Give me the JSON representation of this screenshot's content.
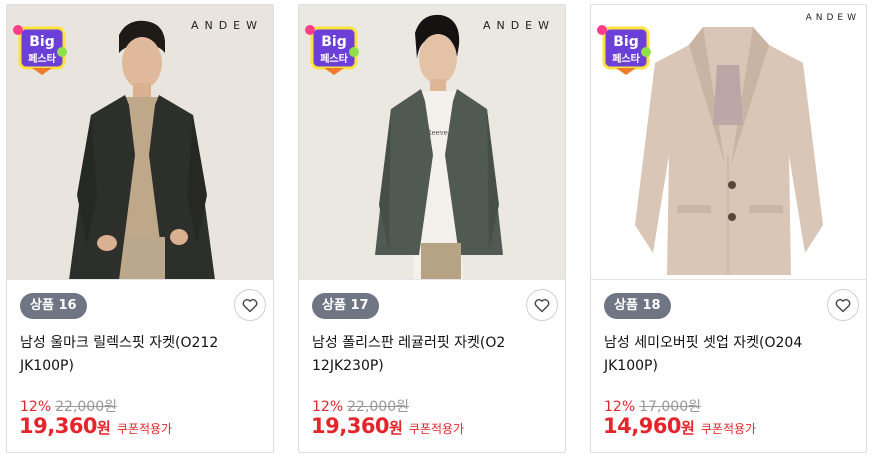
{
  "products": [
    {
      "badge": "상품 16",
      "brand": "ANDEW",
      "name": "남성 울마크 릴렉스핏 자켓(O212JK100P)",
      "discount": "12%",
      "original_price": "22,000원",
      "sale_price": "19,360",
      "currency": "원",
      "coupon_note": "쿠폰적용가"
    },
    {
      "badge": "상품 17",
      "brand": "ANDEW",
      "name": "남성 폴리스판 레귤러핏 자켓(O212JK230P)",
      "discount": "12%",
      "original_price": "22,000원",
      "sale_price": "19,360",
      "currency": "원",
      "coupon_note": "쿠폰적용가"
    },
    {
      "badge": "상품 18",
      "brand": "ANDEW",
      "name": "남성 세미오버핏 셋업 자켓(O204JK100P)",
      "discount": "12%",
      "original_price": "17,000원",
      "sale_price": "14,960",
      "currency": "원",
      "coupon_note": "쿠폰적용가"
    }
  ],
  "promo_badge": {
    "line1": "Big",
    "line2": "페스타"
  },
  "colors": {
    "accent_red": "#e4262c",
    "badge_gray": "#707584"
  },
  "icons": {
    "wishlist": "heart-icon"
  }
}
